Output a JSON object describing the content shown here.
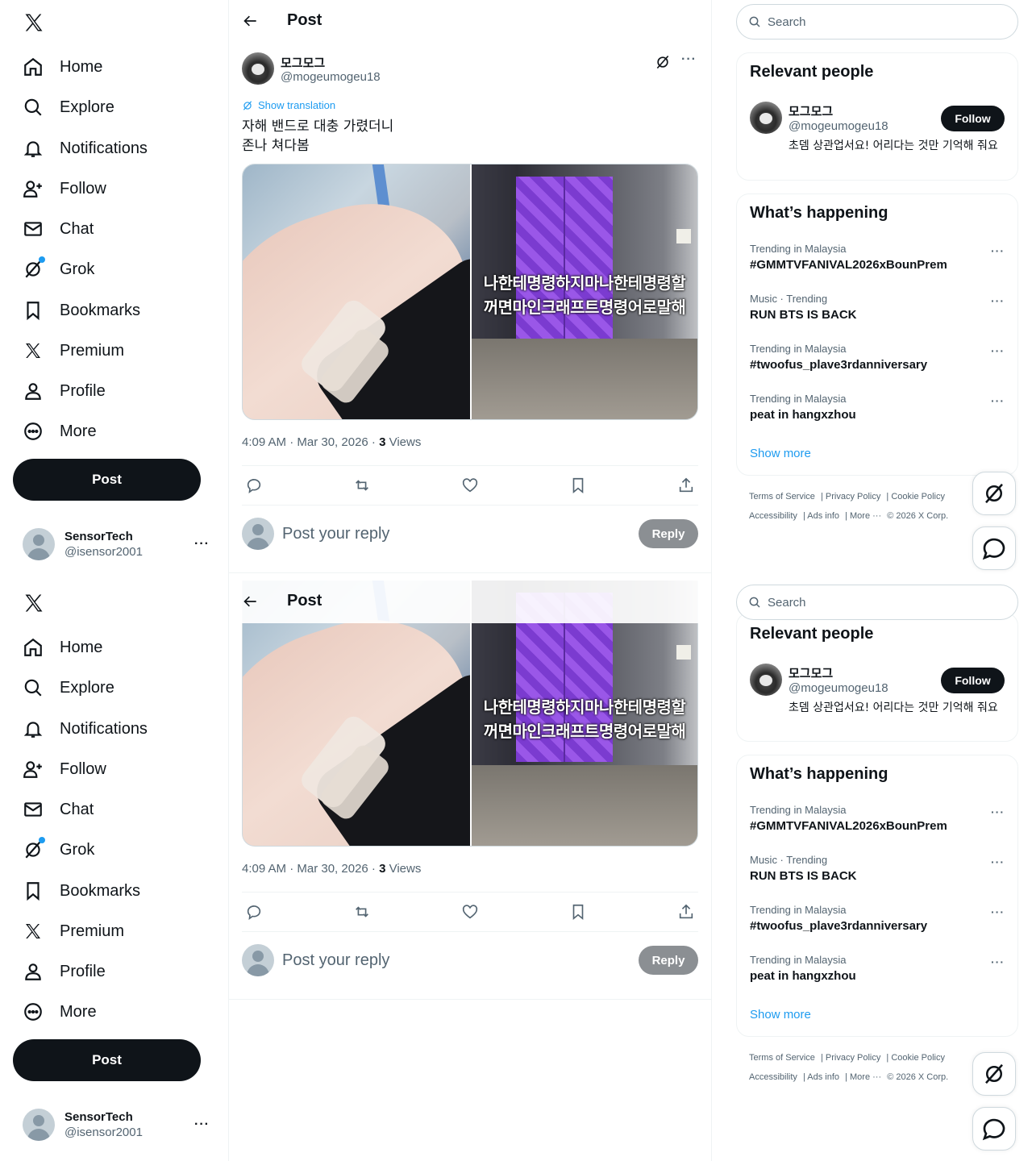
{
  "nav": {
    "items": [
      {
        "label": "Home",
        "icon": "home-icon"
      },
      {
        "label": "Explore",
        "icon": "search-icon"
      },
      {
        "label": "Notifications",
        "icon": "bell-icon"
      },
      {
        "label": "Follow",
        "icon": "person-plus-icon"
      },
      {
        "label": "Chat",
        "icon": "mail-icon"
      },
      {
        "label": "Grok",
        "icon": "grok-icon"
      },
      {
        "label": "Bookmarks",
        "icon": "bookmark-icon"
      },
      {
        "label": "Premium",
        "icon": "x-logo-icon"
      },
      {
        "label": "Profile",
        "icon": "person-icon"
      },
      {
        "label": "More",
        "icon": "more-circle-icon"
      }
    ],
    "post_label": "Post",
    "account": {
      "name": "SensorTech",
      "handle": "@isensor2001",
      "more": "···"
    }
  },
  "header": {
    "title": "Post"
  },
  "tweet": {
    "author_name": "모그모그",
    "author_handle": "@mogeumogeu18",
    "show_translation": "Show translation",
    "text_line1": "자해 밴드로 대충 가렸더니",
    "text_line2": "존나 쳐다봄",
    "image_overlay_line1": "나한테명령하지마나한테명령할",
    "image_overlay_line2": "꺼면마인크래프트명령어로말해",
    "timestamp": "4:09 AM · Mar 30, 2026 · ",
    "views_count": "3",
    "views_label": " Views",
    "reply_placeholder": "Post your reply",
    "reply_button": "Reply"
  },
  "sidebar": {
    "search_placeholder": "Search",
    "relevant_title": "Relevant people",
    "person": {
      "name": "모그모그",
      "handle": "@mogeumogeu18",
      "bio": "초뎀 상관업서요! 어리다는 것만 기억해 줘요",
      "follow": "Follow"
    },
    "happening_title": "What’s happening",
    "trends": [
      {
        "context": "Trending in Malaysia",
        "title": "#GMMTVFANIVAL2026xBounPrem"
      },
      {
        "context": "Music · Trending",
        "title": "RUN BTS IS BACK"
      },
      {
        "context": "Trending in Malaysia",
        "title": "#twoofus_plave3rdanniversary"
      },
      {
        "context": "Trending in Malaysia",
        "title": "peat in hangxzhou"
      }
    ],
    "show_more": "Show more",
    "footer": {
      "terms": "Terms of Service",
      "privacy": "Privacy Policy",
      "cookie": "Cookie Policy",
      "accessibility": "Accessibility",
      "ads": "Ads info",
      "more": "More ···",
      "copyright": "© 2026 X Corp."
    }
  },
  "colors": {
    "accent": "#1d9bf0",
    "text": "#0f1419",
    "muted": "#536471",
    "reply_btn": "#8b8f93"
  }
}
